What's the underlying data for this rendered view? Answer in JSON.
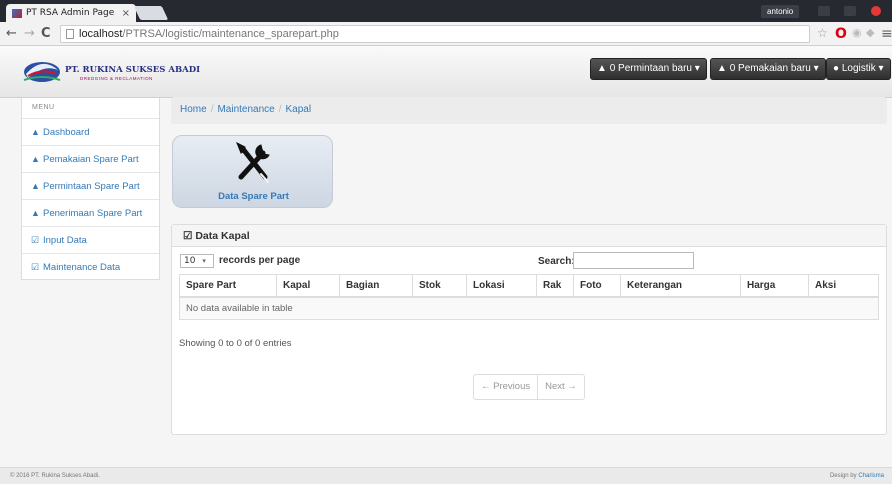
{
  "browser": {
    "tab_title": "PT RSA Admin Page",
    "tab_close": "×",
    "user": "antonio",
    "url_host": "localhost",
    "url_path": "/PTRSA/logistic/maintenance_sparepart.php"
  },
  "navbar": {
    "brand": "PT. RUKINA SUKSES ABADI",
    "brand_sub": "DREDGING & RECLAMATION",
    "permintaan": "0 Permintaan baru",
    "pemakaian": "0 Pemakaian baru",
    "user_menu": "Logistik"
  },
  "sidebar": {
    "title": "MENU",
    "items": [
      {
        "label": "Dashboard"
      },
      {
        "label": "Pemakaian Spare Part"
      },
      {
        "label": "Permintaan Spare Part"
      },
      {
        "label": "Penerimaan Spare Part"
      },
      {
        "label": "Input Data"
      },
      {
        "label": "Maintenance Data"
      }
    ]
  },
  "breadcrumb": [
    "Home",
    "Maintenance",
    "Kapal"
  ],
  "tile": {
    "label": "Data Spare Part"
  },
  "panel": {
    "title": "Data Kapal",
    "length_value": "10",
    "length_label": "records per page",
    "search_label": "Search:",
    "search_value": "",
    "columns": [
      "Spare Part",
      "Kapal",
      "Bagian",
      "Stok",
      "Lokasi",
      "Rak",
      "Foto",
      "Keterangan",
      "Harga",
      "Aksi"
    ],
    "empty_text": "No data available in table",
    "info": "Showing 0 to 0 of 0 entries",
    "prev": "← Previous",
    "next": "Next →"
  },
  "footer": {
    "copyright": "© 2016 PT. Rukina Sukses Abadi.",
    "design_by": "Design by",
    "designer": "Charisma"
  },
  "colors": {
    "link": "#337ab7",
    "navbar_button": "#333333"
  }
}
